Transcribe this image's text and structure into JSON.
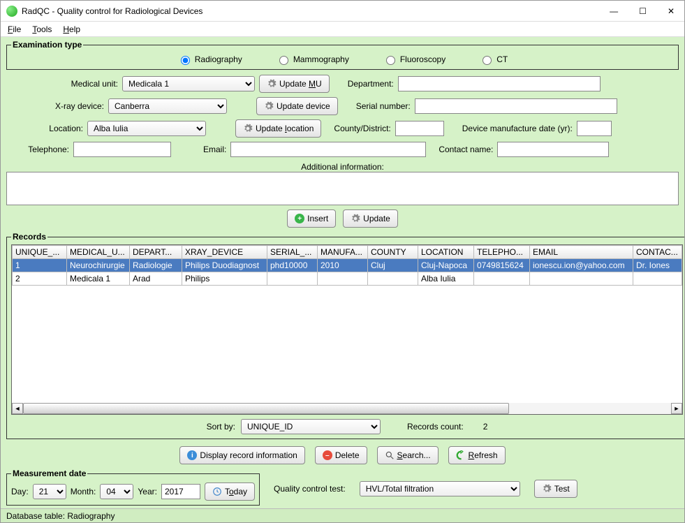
{
  "title": "RadQC - Quality control for Radiological Devices",
  "menu": {
    "file": "File",
    "tools": "Tools",
    "help": "Help"
  },
  "exam": {
    "legend": "Examination type",
    "radiography": "Radiography",
    "mammography": "Mammography",
    "fluoroscopy": "Fluoroscopy",
    "ct": "CT"
  },
  "form": {
    "medical_unit_lbl": "Medical unit:",
    "medical_unit_val": "Medicala 1",
    "update_mu_btn": "Update MU",
    "department_lbl": "Department:",
    "department_val": "",
    "xray_lbl": "X-ray device:",
    "xray_val": "Canberra",
    "update_device_btn": "Update device",
    "serial_lbl": "Serial number:",
    "serial_val": "",
    "location_lbl": "Location:",
    "location_val": "Alba Iulia",
    "update_location_btn": "Update location",
    "county_lbl": "County/District:",
    "county_val": "",
    "mfg_lbl": "Device manufacture date (yr):",
    "mfg_val": "",
    "tel_lbl": "Telephone:",
    "tel_val": "",
    "email_lbl": "Email:",
    "email_val": "",
    "contact_lbl": "Contact name:",
    "contact_val": "",
    "addl_lbl": "Additional information:",
    "insert_btn": "Insert",
    "update_btn": "Update"
  },
  "records": {
    "legend": "Records",
    "cols": [
      "UNIQUE_...",
      "MEDICAL_U...",
      "DEPART...",
      "XRAY_DEVICE",
      "SERIAL_...",
      "MANUFA...",
      "COUNTY",
      "LOCATION",
      "TELEPHO...",
      "EMAIL",
      "CONTAC..."
    ],
    "rows": [
      {
        "c": [
          "1",
          "Neurochirurgie",
          "Radiologie",
          "Philips Duodiagnost",
          "phd10000",
          "2010",
          "Cluj",
          "Cluj-Napoca",
          "0749815624",
          "ionescu.ion@yahoo.com",
          "Dr. Iones"
        ],
        "sel": true
      },
      {
        "c": [
          "2",
          "Medicala 1",
          "Arad",
          "Philips",
          "",
          "",
          "",
          "Alba Iulia",
          "",
          "",
          ""
        ],
        "sel": false
      }
    ],
    "sort_lbl": "Sort by:",
    "sort_val": "UNIQUE_ID",
    "count_lbl": "Records count:",
    "count_val": "2"
  },
  "actions": {
    "display": "Display record information",
    "delete": "Delete",
    "search": "Search...",
    "refresh": "Refresh"
  },
  "measure": {
    "legend": "Measurement date",
    "day_lbl": "Day:",
    "day_val": "21",
    "month_lbl": "Month:",
    "month_val": "04",
    "year_lbl": "Year:",
    "year_val": "2017",
    "today_btn": "Today"
  },
  "qc": {
    "label": "Quality control test:",
    "value": "HVL/Total filtration",
    "test_btn": "Test"
  },
  "status": "Database table: Radiography"
}
